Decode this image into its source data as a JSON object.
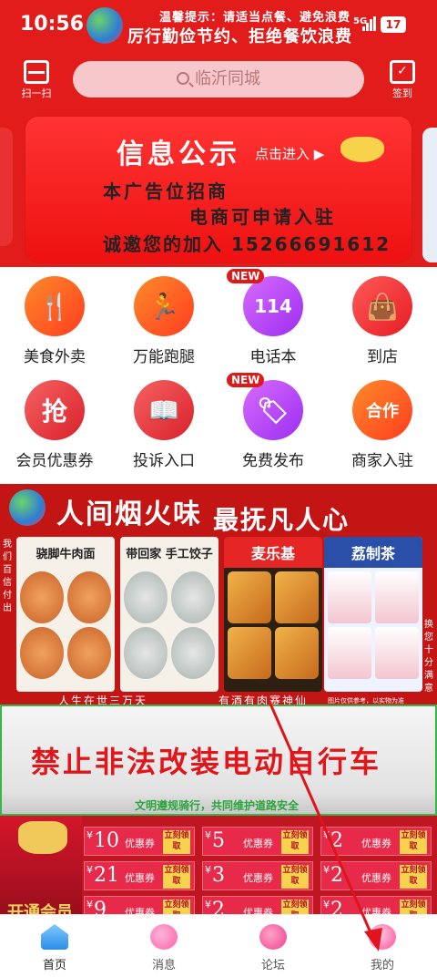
{
  "status_bar": {
    "time": "10:56",
    "tip_line1": "温馨提示：请适当点餐、避免浪费",
    "tip_line2": "厉行勤俭节约、拒绝餐饮浪费",
    "signal": "5G",
    "battery": "17"
  },
  "topbar": {
    "scan_label": "扫一扫",
    "search_placeholder": "临沂同城",
    "signin_label": "签到"
  },
  "banner": {
    "title": "信息公示",
    "click_hint": "点击进入",
    "line1": "本广告位招商",
    "line2": "电商可申请入驻",
    "line3": "诚邀您的加入 15266691612"
  },
  "grid": {
    "items": [
      {
        "label": "美食外卖",
        "icon": "fork-knife-icon"
      },
      {
        "label": "万能跑腿",
        "icon": "runner-icon"
      },
      {
        "label": "电话本",
        "icon": "phone-114-icon",
        "badge": "NEW",
        "glyph": "114"
      },
      {
        "label": "到店",
        "icon": "shopping-bag-icon"
      },
      {
        "label": "会员优惠券",
        "icon": "grab-coupon-icon",
        "glyph": "抢"
      },
      {
        "label": "投诉入口",
        "icon": "book-icon"
      },
      {
        "label": "免费发布",
        "icon": "tag-icon",
        "badge": "NEW"
      },
      {
        "label": "商家入驻",
        "icon": "handshake-icon",
        "glyph": "合作"
      }
    ]
  },
  "poster": {
    "title_a": "人间烟火味",
    "title_b": "最抚凡人心",
    "left_side": "我们百信付出",
    "right_side": "换您十分满意",
    "shops": [
      "骁脚牛肉面",
      "带回家 手工饺子",
      "麦乐基",
      "荔制茶"
    ],
    "bottom_left": "人生在世三万天",
    "bottom_right": "有酒有肉赛神仙",
    "note": "图片仅供参考，以实物为准"
  },
  "warning": {
    "main": "禁止非法改装电动自行车",
    "sub": "文明遵规骑行，共同维护道路安全"
  },
  "coupons": {
    "vip_label": "开通会员",
    "type_label": "优惠券",
    "get_label": "立刻领取",
    "items": [
      {
        "amount": "10"
      },
      {
        "amount": "5"
      },
      {
        "amount": "2"
      },
      {
        "amount": "21"
      },
      {
        "amount": "3"
      },
      {
        "amount": "2"
      },
      {
        "amount": "9"
      },
      {
        "amount": "2"
      },
      {
        "amount": "2"
      }
    ]
  },
  "bottom_nav": {
    "items": [
      {
        "label": "首页",
        "icon": "home-icon",
        "active": true
      },
      {
        "label": "消息",
        "icon": "message-icon"
      },
      {
        "label": "论坛",
        "icon": "forum-icon"
      },
      {
        "label": "我的",
        "icon": "profile-icon"
      }
    ]
  },
  "colors": {
    "brand_red": "#e21b1b",
    "warning_text": "#e0161b",
    "accent_green": "#39b54a"
  }
}
